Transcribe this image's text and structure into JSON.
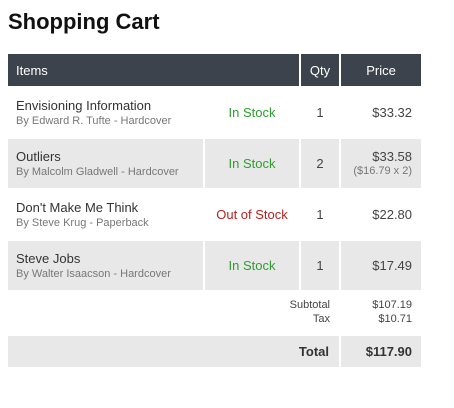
{
  "page": {
    "title": "Shopping Cart"
  },
  "table": {
    "headers": {
      "items": "Items",
      "qty": "Qty",
      "price": "Price"
    },
    "rows": [
      {
        "title": "Envisioning Information",
        "meta": "By Edward R. Tufte - Hardcover",
        "stock": "In Stock",
        "qty": "1",
        "price": "$33.32",
        "breakdown": ""
      },
      {
        "title": "Outliers",
        "meta": "By Malcolm Gladwell - Hardcover",
        "stock": "In Stock",
        "qty": "2",
        "price": "$33.58",
        "breakdown": "($16.79 x 2)"
      },
      {
        "title": "Don't Make Me Think",
        "meta": "By Steve Krug - Paperback",
        "stock": "Out of Stock",
        "qty": "1",
        "price": "$22.80",
        "breakdown": ""
      },
      {
        "title": "Steve Jobs",
        "meta": "By Walter Isaacson - Hardcover",
        "stock": "In Stock",
        "qty": "1",
        "price": "$17.49",
        "breakdown": ""
      }
    ]
  },
  "summary": {
    "subtotal_label": "Subtotal",
    "subtotal_value": "$107.19",
    "tax_label": "Tax",
    "tax_value": "$10.71",
    "total_label": "Total",
    "total_value": "$117.90"
  },
  "colors": {
    "header_bg": "#3d434c",
    "in_stock": "#2f9e2f",
    "out_of_stock": "#b52121",
    "row_shade": "#e8e8e8"
  }
}
